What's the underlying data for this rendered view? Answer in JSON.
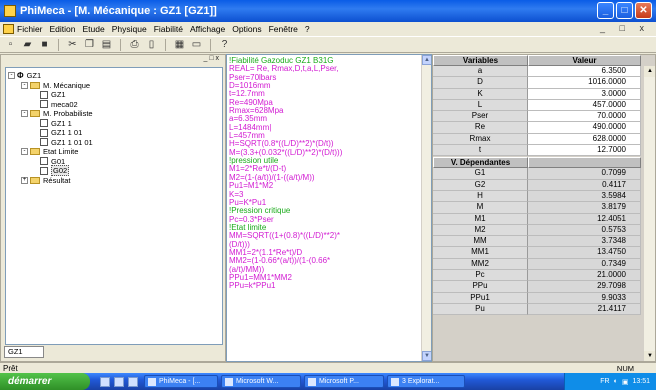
{
  "window": {
    "title": "PhiMeca - [M. Mécanique : GZ1 [GZ1]]"
  },
  "menu": [
    "Fichier",
    "Edition",
    "Etude",
    "Physique",
    "Fiabilité",
    "Affichage",
    "Options",
    "Fenêtre",
    "?"
  ],
  "tree": {
    "pane_controls": "_ □ x",
    "root": "GZ1",
    "items": [
      {
        "label": "M. Mécanique",
        "level": 1,
        "type": "folder",
        "exp": "-"
      },
      {
        "label": "GZ1",
        "level": 2,
        "type": "doc"
      },
      {
        "label": "meca02",
        "level": 2,
        "type": "doc"
      },
      {
        "label": "M. Probabiliste",
        "level": 1,
        "type": "folder",
        "exp": "-"
      },
      {
        "label": "GZ1 1",
        "level": 2,
        "type": "doc"
      },
      {
        "label": "GZ1 1 01",
        "level": 2,
        "type": "doc"
      },
      {
        "label": "GZ1 1 01 01",
        "level": 2,
        "type": "doc"
      },
      {
        "label": "Etat Limite",
        "level": 1,
        "type": "folder",
        "exp": "-"
      },
      {
        "label": "G01",
        "level": 2,
        "type": "doc"
      },
      {
        "label": "G02",
        "level": 2,
        "type": "doc",
        "selected": true
      },
      {
        "label": "Résultat",
        "level": 1,
        "type": "folder",
        "exp": "+"
      }
    ],
    "tab": "GZ1"
  },
  "editor": {
    "lines": [
      {
        "t": "!Fiabilité Gazoduc GZ1 B31G",
        "c": "green"
      },
      {
        "t": "REAL= Re, Rmax,D,t,a,L,Pser,",
        "c": "mag"
      },
      {
        "t": "Pser=70lbars",
        "c": "mag"
      },
      {
        "t": "D=1016mm",
        "c": "mag"
      },
      {
        "t": "t=12.7mm",
        "c": "mag"
      },
      {
        "t": "Re=490Mpa",
        "c": "mag"
      },
      {
        "t": "Rmax=628Mpa",
        "c": "mag"
      },
      {
        "t": "a=6.35mm",
        "c": "mag"
      },
      {
        "t": "L=1484mm|",
        "c": "mag"
      },
      {
        "t": "L=457mm",
        "c": "mag"
      },
      {
        "t": "H=SQRT(0.8*((L/D)**2)*(D/t))",
        "c": "mag"
      },
      {
        "t": "M=(3.3+(0.032*((L/D)**2)*(D/t)))",
        "c": "mag"
      },
      {
        "t": "!pression utile",
        "c": "green"
      },
      {
        "t": "M1=2*Re*t/(D-t)",
        "c": "mag"
      },
      {
        "t": "M2=(1-(a/t))/(1-((a/t)/M))",
        "c": "mag"
      },
      {
        "t": "Pu1=M1*M2",
        "c": "mag"
      },
      {
        "t": "K=3",
        "c": "mag"
      },
      {
        "t": "Pu=K*Pu1",
        "c": "mag"
      },
      {
        "t": "!Pression critique",
        "c": "green"
      },
      {
        "t": "Pc=0.3*Pser",
        "c": "mag"
      },
      {
        "t": "!Etat limite",
        "c": "green"
      },
      {
        "t": "MM=SQRT((1+(0.8)*((L/D)**2)*",
        "c": "mag"
      },
      {
        "t": "(D/t)))",
        "c": "mag"
      },
      {
        "t": "MM1=2*(1.1*Re*t)/D",
        "c": "mag"
      },
      {
        "t": "MM2=(1-0.66*(a/t))/(1-(0.66*",
        "c": "mag"
      },
      {
        "t": "(a/t)/MM))",
        "c": "mag"
      },
      {
        "t": "PPu1=MM1*MM2",
        "c": "mag"
      },
      {
        "t": "PPu=k*PPu1",
        "c": "mag"
      }
    ]
  },
  "variables": {
    "header_name": "Variables",
    "header_value": "Valeur",
    "rows": [
      {
        "name": "a",
        "value": "6.3500"
      },
      {
        "name": "D",
        "value": "1016.0000"
      },
      {
        "name": "K",
        "value": "3.0000"
      },
      {
        "name": "L",
        "value": "457.0000"
      },
      {
        "name": "Pser",
        "value": "70.0000"
      },
      {
        "name": "Re",
        "value": "490.0000"
      },
      {
        "name": "Rmax",
        "value": "628.0000"
      },
      {
        "name": "t",
        "value": "12.7000"
      }
    ],
    "dep_header": "V. Dépendantes",
    "dep_rows": [
      {
        "name": "G1",
        "value": "0.7099"
      },
      {
        "name": "G2",
        "value": "0.4117"
      },
      {
        "name": "H",
        "value": "3.5984"
      },
      {
        "name": "M",
        "value": "3.8179"
      },
      {
        "name": "M1",
        "value": "12.4051"
      },
      {
        "name": "M2",
        "value": "0.5753"
      },
      {
        "name": "MM",
        "value": "3.7348"
      },
      {
        "name": "MM1",
        "value": "13.4750"
      },
      {
        "name": "MM2",
        "value": "0.7349"
      },
      {
        "name": "Pc",
        "value": "21.0000"
      },
      {
        "name": "PPu",
        "value": "29.7098"
      },
      {
        "name": "PPu1",
        "value": "9.9033"
      },
      {
        "name": "Pu",
        "value": "21.4117"
      }
    ]
  },
  "statusbar": {
    "left": "Prêt",
    "right": "NUM"
  },
  "taskbar": {
    "start": "démarrer",
    "tasks": [
      "PhiMeca - [...",
      "Microsoft W...",
      "Microsoft P...",
      "3 Explorat..."
    ],
    "tray_lang": "FR",
    "time": "13:51"
  }
}
